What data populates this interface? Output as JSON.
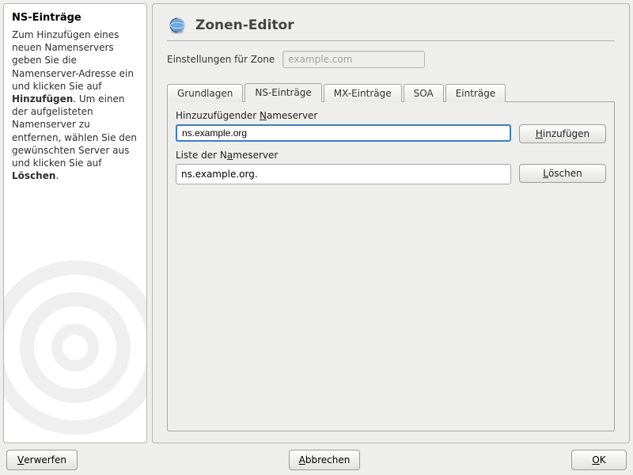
{
  "side": {
    "title": "NS-Einträge",
    "body_before_add": "Zum Hinzufügen eines neuen Namenservers geben Sie die Namenserver-Adresse ein und klicken Sie auf ",
    "add_word": "Hinzufügen",
    "body_mid": ". Um einen der aufgelisteten Namenserver zu entfernen, wählen Sie den gewünschten Server aus und klicken Sie auf ",
    "delete_word": "Löschen",
    "body_after": "."
  },
  "header": {
    "title": "Zonen-Editor"
  },
  "zone": {
    "label": "Einstellungen für Zone",
    "placeholder": "example.com"
  },
  "tabs": {
    "items": [
      {
        "label": "Grundlagen"
      },
      {
        "label": "NS-Einträge"
      },
      {
        "label": "MX-Einträge"
      },
      {
        "label": "SOA"
      },
      {
        "label": "Einträge"
      }
    ],
    "active_index": 1
  },
  "ns": {
    "add_label_pre": "Hinzuzufügender ",
    "add_label_ul": "N",
    "add_label_post": "ameserver",
    "input_value": "ns.example.org",
    "list_label_pre": "Liste der N",
    "list_label_ul": "a",
    "list_label_post": "meserver",
    "items": [
      "ns.example.org."
    ],
    "btn_add_pre": "",
    "btn_add_ul": "H",
    "btn_add_post": "inzufügen",
    "btn_del_pre": "",
    "btn_del_ul": "L",
    "btn_del_post": "öschen"
  },
  "bottom": {
    "discard_pre": "",
    "discard_ul": "V",
    "discard_post": "erwerfen",
    "cancel_pre": "",
    "cancel_ul": "A",
    "cancel_post": "bbrechen",
    "ok_pre": "",
    "ok_ul": "O",
    "ok_post": "K"
  }
}
